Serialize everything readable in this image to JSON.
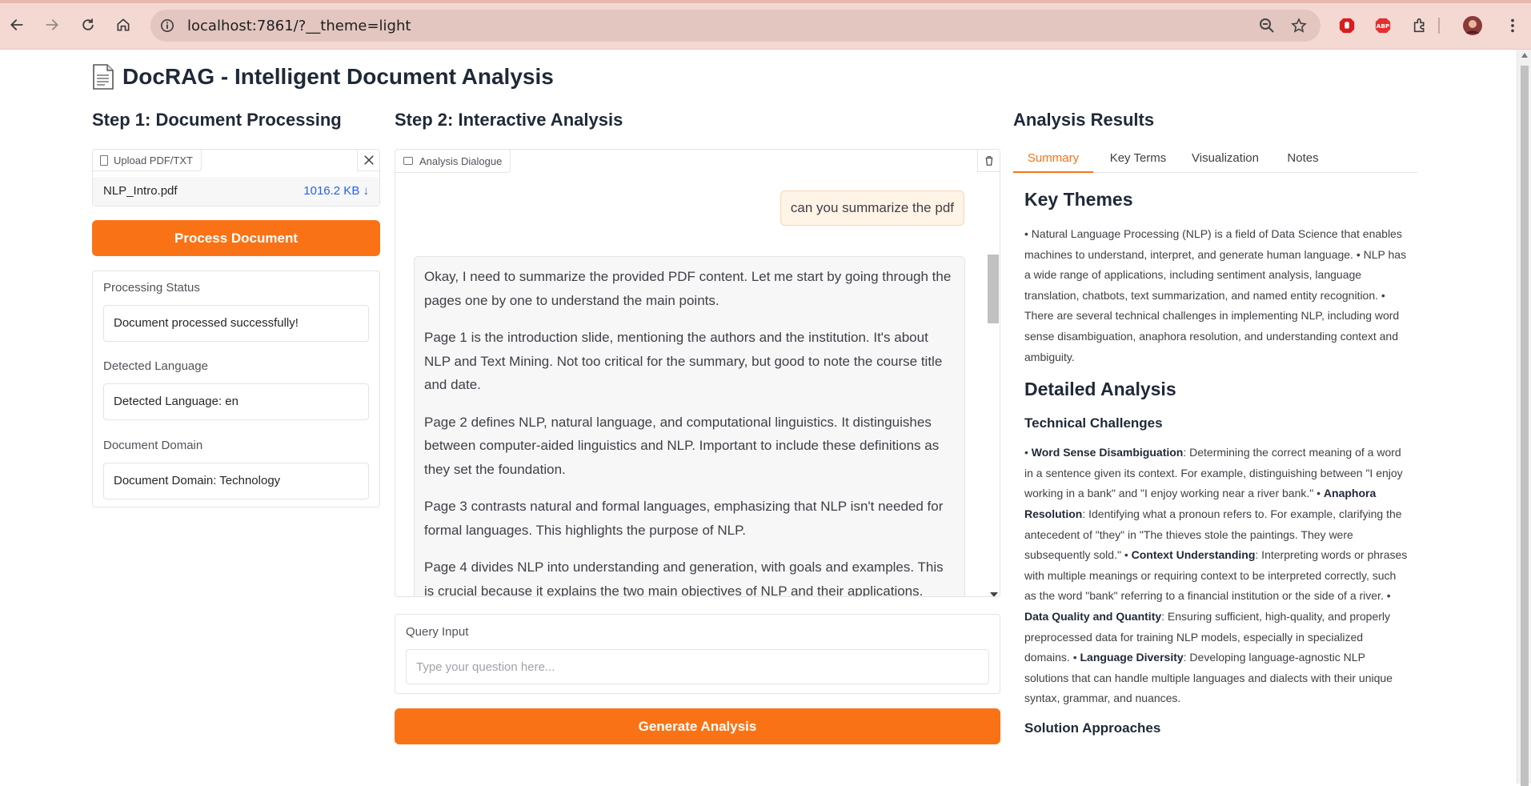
{
  "browser": {
    "url": "localhost:7861/?__theme=light"
  },
  "app": {
    "title": "DocRAG - Intelligent Document Analysis"
  },
  "step1": {
    "title": "Step 1: Document Processing",
    "upload_label": "Upload PDF/TXT",
    "file_name": "NLP_Intro.pdf",
    "file_size": "1016.2 KB ↓",
    "process_button": "Process Document",
    "status_label": "Processing Status",
    "status_value": "Document processed successfully!",
    "language_label": "Detected Language",
    "language_value": "Detected Language: en",
    "domain_label": "Document Domain",
    "domain_value": "Document Domain: Technology"
  },
  "step2": {
    "title": "Step 2: Interactive Analysis",
    "chat_label": "Analysis Dialogue",
    "user_message": "can you summarize the pdf",
    "bot_paragraphs": [
      "Okay, I need to summarize the provided PDF content. Let me start by going through the pages one by one to understand the main points.",
      "Page 1 is the introduction slide, mentioning the authors and the institution. It's about NLP and Text Mining. Not too critical for the summary, but good to note the course title and date.",
      "Page 2 defines NLP, natural language, and computational linguistics. It distinguishes between computer-aided linguistics and NLP. Important to include these definitions as they set the foundation.",
      "Page 3 contrasts natural and formal languages, emphasizing that NLP isn't needed for formal languages. This highlights the purpose of NLP.",
      "Page 4 divides NLP into understanding and generation, with goals and examples. This is crucial because it explains the two main objectives of NLP and their applications."
    ],
    "query_label": "Query Input",
    "query_placeholder": "Type your question here...",
    "generate_button": "Generate Analysis"
  },
  "results": {
    "title": "Analysis Results",
    "tabs": [
      "Summary",
      "Key Terms",
      "Visualization",
      "Notes"
    ],
    "key_themes_heading": "Key Themes",
    "key_themes_text": "• Natural Language Processing (NLP) is a field of Data Science that enables machines to understand, interpret, and generate human language. • NLP has a wide range of applications, including sentiment analysis, language translation, chatbots, text summarization, and named entity recognition. • There are several technical challenges in implementing NLP, including word sense disambiguation, anaphora resolution, and understanding context and ambiguity.",
    "detailed_heading": "Detailed Analysis",
    "technical_heading": "Technical Challenges",
    "challenges": [
      {
        "term": "Word Sense Disambiguation",
        "text": ": Determining the correct meaning of a word in a sentence given its context. For example, distinguishing between \"I enjoy working in a bank\" and \"I enjoy working near a river bank.\" "
      },
      {
        "term": "Anaphora Resolution",
        "text": ": Identifying what a pronoun refers to. For example, clarifying the antecedent of \"they\" in \"The thieves stole the paintings. They were subsequently sold.\" "
      },
      {
        "term": "Context Understanding",
        "text": ": Interpreting words or phrases with multiple meanings or requiring context to be interpreted correctly, such as the word \"bank\" referring to a financial institution or the side of a river. "
      },
      {
        "term": "Data Quality and Quantity",
        "text": ": Ensuring sufficient, high-quality, and properly preprocessed data for training NLP models, especially in specialized domains. "
      },
      {
        "term": "Language Diversity",
        "text": ": Developing language-agnostic NLP solutions that can handle multiple languages and dialects with their unique syntax, grammar, and nuances."
      }
    ],
    "solution_heading": "Solution Approaches"
  },
  "colors": {
    "accent": "#f97316",
    "chrome": "#f4d9d3",
    "link": "#2563eb"
  }
}
